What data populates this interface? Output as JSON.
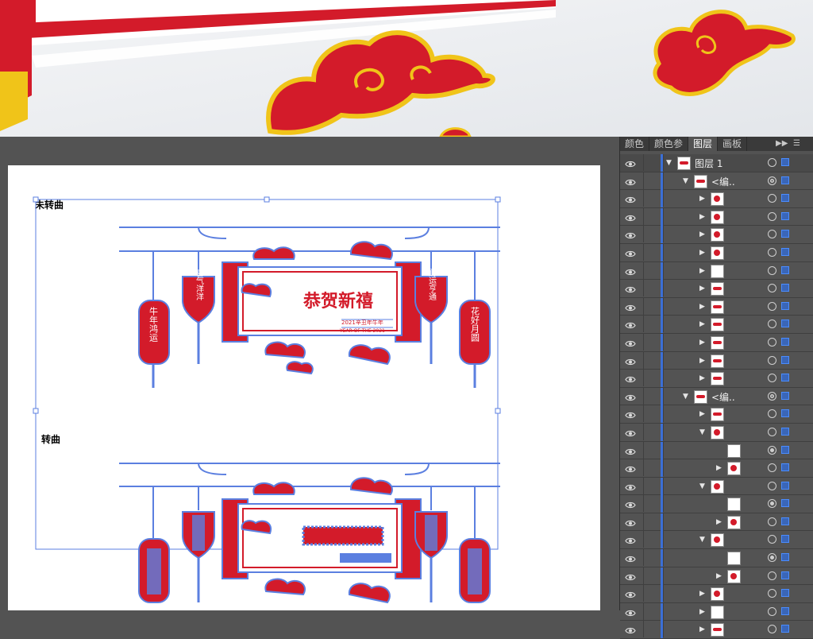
{
  "panel": {
    "tabs": [
      {
        "label": "颜色",
        "active": false
      },
      {
        "label": "颜色参",
        "active": false
      },
      {
        "label": "图层",
        "active": true
      },
      {
        "label": "画板",
        "active": false
      }
    ],
    "collapse_icon": "double-chevron-right-icon",
    "menu_icon": "panel-menu-icon"
  },
  "layers": [
    {
      "indent": 0,
      "expand": "down",
      "thumb": "wide",
      "name": "图层  1",
      "target": "open",
      "top": true
    },
    {
      "indent": 1,
      "expand": "down",
      "thumb": "wide",
      "name": "<编..",
      "target": "double"
    },
    {
      "indent": 2,
      "expand": "right",
      "thumb": "dot",
      "name": "",
      "target": "open"
    },
    {
      "indent": 2,
      "expand": "right",
      "thumb": "dot",
      "name": "",
      "target": "open"
    },
    {
      "indent": 2,
      "expand": "right",
      "thumb": "dot",
      "name": "",
      "target": "open"
    },
    {
      "indent": 2,
      "expand": "right",
      "thumb": "dot",
      "name": "",
      "target": "open"
    },
    {
      "indent": 2,
      "expand": "right",
      "thumb": "blank",
      "name": "",
      "target": "open"
    },
    {
      "indent": 2,
      "expand": "right",
      "thumb": "wide",
      "name": "",
      "target": "open"
    },
    {
      "indent": 2,
      "expand": "right",
      "thumb": "wide",
      "name": "",
      "target": "open"
    },
    {
      "indent": 2,
      "expand": "right",
      "thumb": "wide",
      "name": "",
      "target": "open"
    },
    {
      "indent": 2,
      "expand": "right",
      "thumb": "wide",
      "name": "",
      "target": "open"
    },
    {
      "indent": 2,
      "expand": "right",
      "thumb": "wide",
      "name": "",
      "target": "open"
    },
    {
      "indent": 2,
      "expand": "right",
      "thumb": "wide",
      "name": "",
      "target": "open"
    },
    {
      "indent": 1,
      "expand": "down",
      "thumb": "wide",
      "name": "<编..",
      "target": "double"
    },
    {
      "indent": 2,
      "expand": "right",
      "thumb": "wide",
      "name": "",
      "target": "open"
    },
    {
      "indent": 2,
      "expand": "down",
      "thumb": "dot",
      "name": "",
      "target": "open"
    },
    {
      "indent": 3,
      "expand": "",
      "thumb": "blank",
      "name": "",
      "target": "filled"
    },
    {
      "indent": 3,
      "expand": "right",
      "thumb": "dot",
      "name": "",
      "target": "open"
    },
    {
      "indent": 2,
      "expand": "down",
      "thumb": "dot",
      "name": "",
      "target": "open"
    },
    {
      "indent": 3,
      "expand": "",
      "thumb": "blank",
      "name": "",
      "target": "filled"
    },
    {
      "indent": 3,
      "expand": "right",
      "thumb": "dot",
      "name": "",
      "target": "open"
    },
    {
      "indent": 2,
      "expand": "down",
      "thumb": "dot",
      "name": "",
      "target": "open"
    },
    {
      "indent": 3,
      "expand": "",
      "thumb": "blank",
      "name": "",
      "target": "filled"
    },
    {
      "indent": 3,
      "expand": "right",
      "thumb": "dot",
      "name": "",
      "target": "open"
    },
    {
      "indent": 2,
      "expand": "right",
      "thumb": "dot",
      "name": "",
      "target": "open"
    },
    {
      "indent": 2,
      "expand": "right",
      "thumb": "blank",
      "name": "",
      "target": "open"
    },
    {
      "indent": 2,
      "expand": "right",
      "thumb": "wide",
      "name": "",
      "target": "open"
    }
  ],
  "artboard": {
    "label_top": "未转曲",
    "label_bottom": "转曲",
    "banner_text": "恭贺新禧",
    "subtitle_1": "2021辛丑年牛年",
    "subtitle_2": "YEAR OF THE 2021",
    "lantern_left_outer": "牛年鸿运",
    "lantern_left_inner": "喜气洋洋",
    "lantern_right_inner": "财运亨通",
    "lantern_right_outer": "花好月圆"
  },
  "colors": {
    "red": "#d31b2a",
    "selection_blue": "#5b7fe0",
    "panel_bg": "#535353",
    "gold": "#f0c419"
  }
}
